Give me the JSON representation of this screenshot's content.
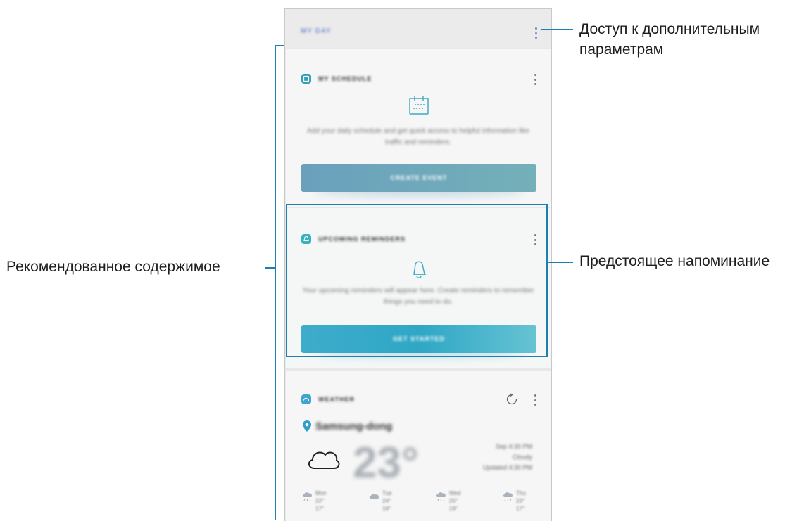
{
  "header": {
    "title": "MY DAY",
    "more_options": "more-options"
  },
  "cards": {
    "schedule": {
      "title": "MY SCHEDULE",
      "body": "Add your daily schedule and get quick access to helpful information like traffic and reminders.",
      "button": "CREATE EVENT"
    },
    "reminders": {
      "title": "UPCOMING REMINDERS",
      "body": "Your upcoming reminders will appear here. Create reminders to remember things you need to do.",
      "button": "GET STARTED"
    },
    "weather": {
      "title": "WEATHER",
      "location": "Samsung-dong",
      "temperature": "23°",
      "side_lines": [
        "Sep 4:30 PM",
        "Cloudy",
        "Updated 4:30 PM"
      ],
      "forecast": [
        {
          "day": "Mon",
          "hi": "22°",
          "lo": "17°"
        },
        {
          "day": "Tue",
          "hi": "24°",
          "lo": "18°"
        },
        {
          "day": "Wed",
          "hi": "25°",
          "lo": "19°"
        },
        {
          "day": "Thu",
          "hi": "23°",
          "lo": "17°"
        }
      ]
    }
  },
  "callouts": {
    "more_options": "Доступ к дополнительным параметрам",
    "upcoming_reminder": "Предстоящее напоминание",
    "recommended": "Рекомендованное содержимое"
  },
  "colors": {
    "accent": "#1f7fb3",
    "schedule_button": "#6fa5bd",
    "reminder_button": "#4fb9cf",
    "icon_teal": "#3fa5bf"
  },
  "icons": [
    "more-vert-icon",
    "calendar-icon",
    "bell-icon",
    "cloud-icon",
    "refresh-icon",
    "location-pin-icon",
    "rain-cloud-icon"
  ]
}
